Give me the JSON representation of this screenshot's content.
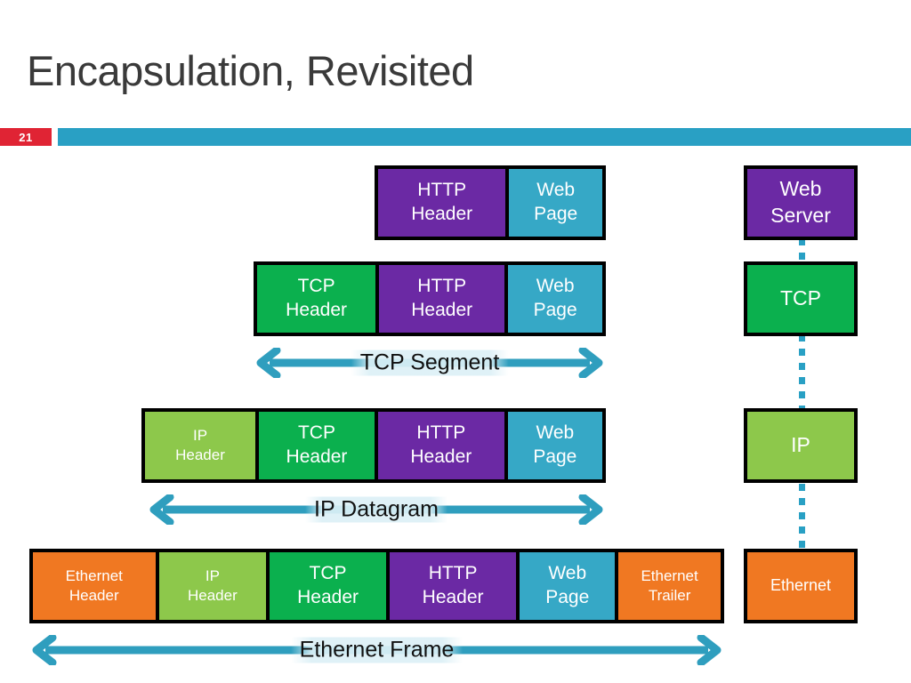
{
  "slide": {
    "title": "Encapsulation, Revisited",
    "number": "21"
  },
  "colors": {
    "purple": "#6B29A4",
    "teal": "#36A8C6",
    "green": "#0BB04E",
    "light_green": "#8DC84B",
    "orange": "#F07822",
    "accent_bar": "#29A0C4",
    "badge_red": "#E02434",
    "title_gray": "#3A3A3A",
    "outline": "#000000"
  },
  "rows": [
    {
      "name": "http-row",
      "cells": [
        {
          "line1": "HTTP",
          "line2": "Header",
          "color": "#6B29A4"
        },
        {
          "line1": "Web",
          "line2": "Page",
          "color": "#36A8C6"
        }
      ]
    },
    {
      "name": "tcp-row",
      "cells": [
        {
          "line1": "TCP",
          "line2": "Header",
          "color": "#0BB04E"
        },
        {
          "line1": "HTTP",
          "line2": "Header",
          "color": "#6B29A4"
        },
        {
          "line1": "Web",
          "line2": "Page",
          "color": "#36A8C6"
        }
      ]
    },
    {
      "name": "ip-row",
      "cells": [
        {
          "line1": "IP",
          "line2": "Header",
          "color": "#8DC84B"
        },
        {
          "line1": "TCP",
          "line2": "Header",
          "color": "#0BB04E"
        },
        {
          "line1": "HTTP",
          "line2": "Header",
          "color": "#6B29A4"
        },
        {
          "line1": "Web",
          "line2": "Page",
          "color": "#36A8C6"
        }
      ]
    },
    {
      "name": "ethernet-row",
      "cells": [
        {
          "line1": "Ethernet",
          "line2": "Header",
          "color": "#F07822"
        },
        {
          "line1": "IP",
          "line2": "Header",
          "color": "#8DC84B"
        },
        {
          "line1": "TCP",
          "line2": "Header",
          "color": "#0BB04E"
        },
        {
          "line1": "HTTP",
          "line2": "Header",
          "color": "#6B29A4"
        },
        {
          "line1": "Web",
          "line2": "Page",
          "color": "#36A8C6"
        },
        {
          "line1": "Ethernet",
          "line2": "Trailer",
          "color": "#F07822"
        }
      ]
    }
  ],
  "arrows": [
    {
      "label": "TCP Segment"
    },
    {
      "label": "IP Datagram"
    },
    {
      "label": "Ethernet Frame"
    }
  ],
  "layers": [
    {
      "line1": "Web",
      "line2": "Server",
      "color": "#6B29A4"
    },
    {
      "line1": "TCP",
      "line2": "",
      "color": "#0BB04E"
    },
    {
      "line1": "IP",
      "line2": "",
      "color": "#8DC84B"
    },
    {
      "line1": "Ethernet",
      "line2": "",
      "color": "#F07822"
    }
  ]
}
